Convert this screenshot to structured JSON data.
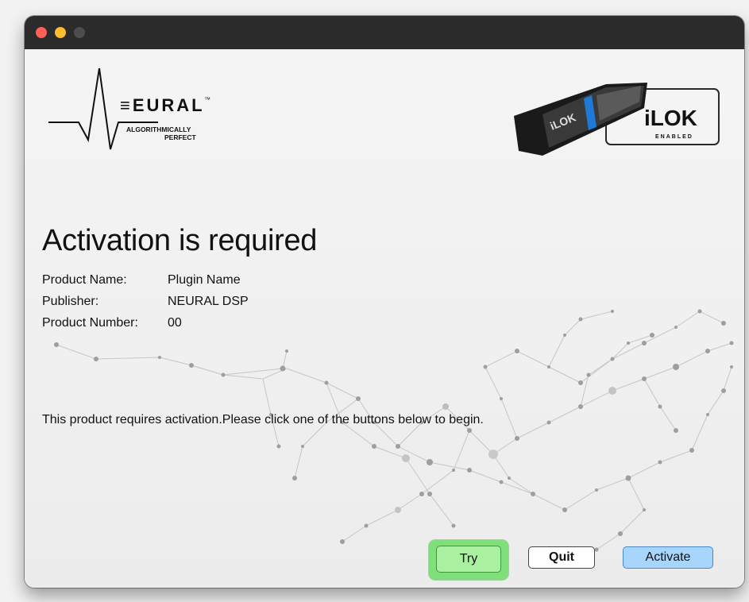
{
  "window": {
    "buttons": [
      "close",
      "minimize",
      "maximize"
    ]
  },
  "logo": {
    "brand": "EURAL",
    "trademark": "™",
    "tagline_line1": "ALGORITHMICALLY",
    "tagline_line2": "PERFECT"
  },
  "ilok_badge": {
    "brand": "iLOK",
    "subtitle": "ENABLED",
    "dongle_text": "iLOK"
  },
  "main": {
    "heading": "Activation is required",
    "info": [
      {
        "label": "Product Name:",
        "value": "Plugin Name"
      },
      {
        "label": "Publisher:",
        "value": "NEURAL DSP"
      },
      {
        "label": "Product Number:",
        "value": "00"
      }
    ],
    "message": "This product requires activation.Please click one of the buttons below to begin."
  },
  "buttons": {
    "try": "Try",
    "quit": "Quit",
    "activate": "Activate"
  },
  "colors": {
    "titlebar": "#2b2b2b",
    "close": "#ff5f57",
    "minimize": "#febc2e",
    "try_highlight": "#7fe07a",
    "activate_blue": "#a7d5fb",
    "ilok_accent": "#1e7ad6"
  }
}
